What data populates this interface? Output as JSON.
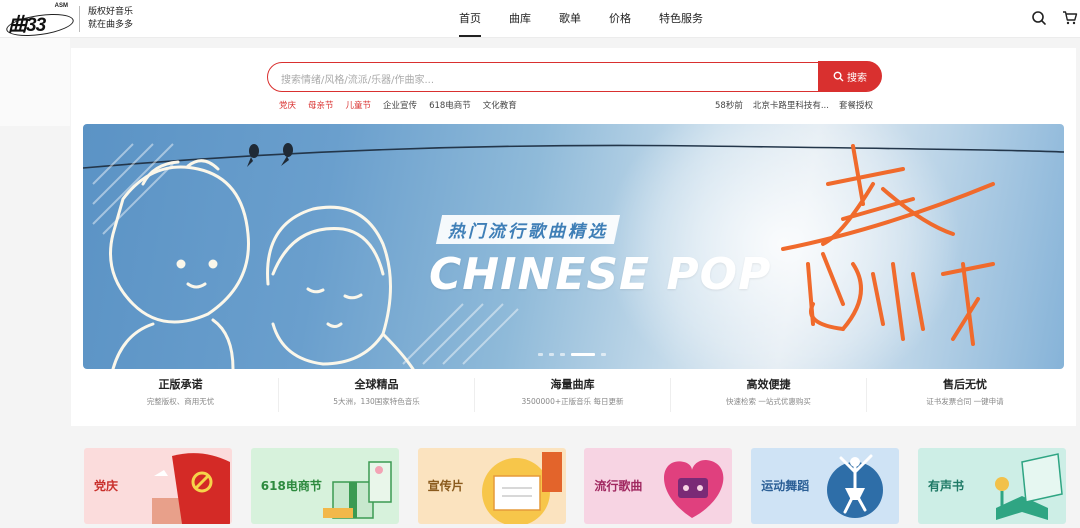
{
  "brand": {
    "asm": "ASM",
    "mark": "曲33",
    "slogan_line1": "版权好音乐",
    "slogan_line2": "就在曲多多"
  },
  "nav": {
    "items": [
      "首页",
      "曲库",
      "歌单",
      "价格",
      "特色服务"
    ],
    "active": "首页"
  },
  "header_icons": [
    "search-icon",
    "cart-icon"
  ],
  "search": {
    "placeholder": "搜索情绪/风格/流派/乐器/作曲家...",
    "button_label": "搜索"
  },
  "tags": {
    "left": [
      {
        "label": "党庆",
        "hot": true
      },
      {
        "label": "母亲节",
        "hot": true
      },
      {
        "label": "儿童节",
        "hot": true
      },
      {
        "label": "企业宣传",
        "hot": false
      },
      {
        "label": "618电商节",
        "hot": false
      },
      {
        "label": "文化教育",
        "hot": false
      }
    ],
    "right": [
      "58秒前",
      "北京卡路里科技有...",
      "套餐授权"
    ]
  },
  "banner": {
    "title": "热门流行歌曲精选",
    "subtitle": "CHINESE POP",
    "calligraphy": "流行",
    "slides": 5,
    "active_slide": 4
  },
  "features": [
    {
      "title": "正版承诺",
      "sub": "完整版权、商用无忧"
    },
    {
      "title": "全球精品",
      "sub": "5大洲，130国家特色音乐"
    },
    {
      "title": "海量曲库",
      "sub": "3500000+正版音乐 每日更新"
    },
    {
      "title": "高效便捷",
      "sub": "快速检索 一站式优惠购买"
    },
    {
      "title": "售后无忧",
      "sub": "证书发票合同 一键申请"
    }
  ],
  "categories": [
    {
      "label": "党庆",
      "color": "#c9302c",
      "bg": "#fbdcdc"
    },
    {
      "label": "618电商节",
      "color": "#2d8a3e",
      "bg": "#d7f2dc"
    },
    {
      "label": "宣传片",
      "color": "#8a5a1c",
      "bg": "#fbe3bf"
    },
    {
      "label": "流行歌曲",
      "color": "#a02860",
      "bg": "#f7d4e3"
    },
    {
      "label": "运动舞蹈",
      "color": "#2b5f96",
      "bg": "#cfe3f5"
    },
    {
      "label": "有声书",
      "color": "#1f7a66",
      "bg": "#cdeee6"
    }
  ],
  "colors": {
    "accent": "#d9302f",
    "banner_blue": "#5b93c5",
    "calligraphy_orange": "#f06a2c"
  }
}
